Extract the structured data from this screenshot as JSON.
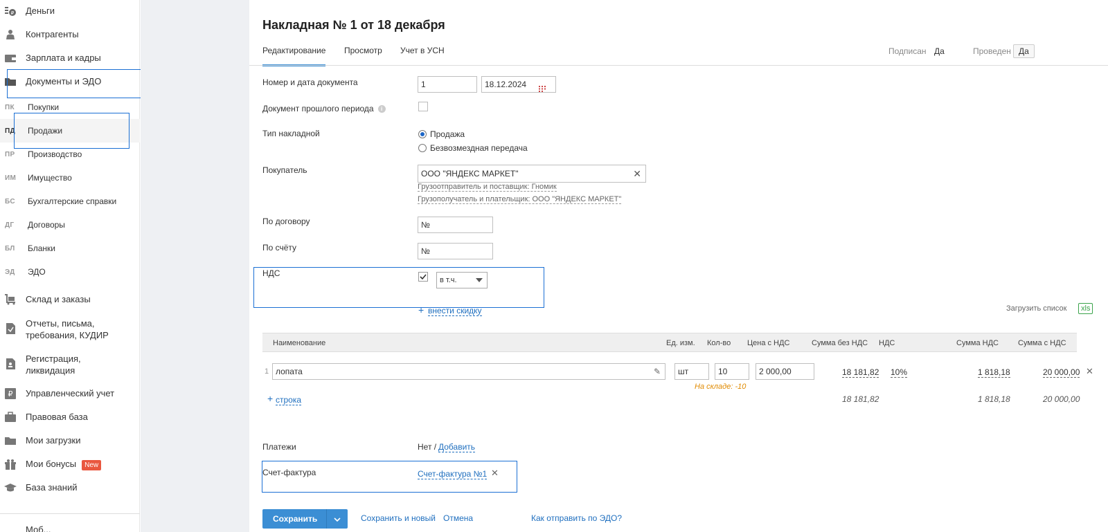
{
  "sidebar": {
    "top_items": [
      {
        "label": "Деньги",
        "icon": "money-icon"
      },
      {
        "label": "Контрагенты",
        "icon": "contractors-icon"
      },
      {
        "label": "Зарплата и кадры",
        "icon": "wallet-icon"
      },
      {
        "label": "Документы и ЭДО",
        "icon": "folder-icon"
      }
    ],
    "sub_items": [
      {
        "abbr": "ПК",
        "label": "Покупки"
      },
      {
        "abbr": "ПД",
        "label": "Продажи"
      },
      {
        "abbr": "ПР",
        "label": "Производство"
      },
      {
        "abbr": "ИМ",
        "label": "Имущество"
      },
      {
        "abbr": "БС",
        "label": "Бухгалтерские справки"
      },
      {
        "abbr": "ДГ",
        "label": "Договоры"
      },
      {
        "abbr": "БЛ",
        "label": "Бланки"
      },
      {
        "abbr": "ЭД",
        "label": "ЭДО"
      }
    ],
    "bottom_items": [
      {
        "label": "Склад и заказы",
        "icon": "cart-icon"
      },
      {
        "label": "Отчеты, письма,",
        "label2": "требования, КУДИР",
        "icon": "report-icon"
      },
      {
        "label": "Регистрация,",
        "label2": "ликвидация",
        "icon": "registration-icon"
      },
      {
        "label": "Управленческий учет",
        "icon": "ruble-icon"
      },
      {
        "label": "Правовая база",
        "icon": "briefcase-icon"
      },
      {
        "label": "Мои загрузки",
        "icon": "folder-icon"
      },
      {
        "label": "Мои бонусы",
        "icon": "gift-icon",
        "badge": "New"
      },
      {
        "label": "База знаний",
        "icon": "graduation-cap-icon"
      }
    ],
    "cutoff_label": "Моб..."
  },
  "document": {
    "title": "Накладная № 1 от 18 декабря",
    "tabs": [
      "Редактирование",
      "Просмотр",
      "Учет в УСН"
    ],
    "signed_label": "Подписан",
    "signed_value": "Да",
    "posted_label": "Проведен",
    "posted_value": "Да"
  },
  "form": {
    "doc_number_label": "Номер и дата документа",
    "doc_number": "1",
    "doc_date": "18.12.2024",
    "past_period_label": "Документ прошлого периода",
    "type_label": "Тип накладной",
    "type_options": [
      "Продажа",
      "Безвозмездная передача"
    ],
    "buyer_label": "Покупатель",
    "buyer_value": "ООО \"ЯНДЕКС МАРКЕТ\"",
    "shipper_link": "Грузоотправитель и поставщик: Гномик",
    "consignee_link": "Грузополучатель и плательщик: ООО \"ЯНДЕКС МАРКЕТ\"",
    "contract_label": "По договору",
    "contract_placeholder": "№",
    "invoice_label": "По счёту",
    "invoice_placeholder": "№",
    "vat_label": "НДС",
    "vat_mode": "в т.ч.",
    "discount_link": "внести скидку",
    "upload_list": "Загрузить список",
    "xls": "xls"
  },
  "table": {
    "headers": [
      "Наименование",
      "Ед. изм.",
      "Кол-во",
      "Цена с НДС",
      "Сумма без НДС",
      "НДС",
      "Сумма НДС",
      "Сумма с НДС"
    ],
    "rows": [
      {
        "num": "1",
        "name": "лопата",
        "unit": "шт",
        "qty": "10",
        "price": "2 000,00",
        "sum_no_vat": "18 181,82",
        "vat": "10%",
        "vat_sum": "1 818,18",
        "total": "20 000,00",
        "stock_warning": "На складе: -10"
      }
    ],
    "add_row": "строка",
    "totals": {
      "sum_no_vat": "18 181,82",
      "vat_sum": "1 818,18",
      "total": "20 000,00"
    }
  },
  "payments": {
    "label": "Платежи",
    "none": "Нет /",
    "add_link": "Добавить"
  },
  "invoice_doc": {
    "label": "Счет-фактура",
    "link": "Счет-фактура №1"
  },
  "footer": {
    "save": "Сохранить",
    "save_new": "Сохранить и новый",
    "cancel": "Отмена",
    "edo_link": "Как отправить по ЭДО?"
  },
  "colors": {
    "accent": "#3b8ed4",
    "highlight": "#1a6fd4",
    "warning": "#e08a00",
    "badge_new": "#e9573f"
  }
}
